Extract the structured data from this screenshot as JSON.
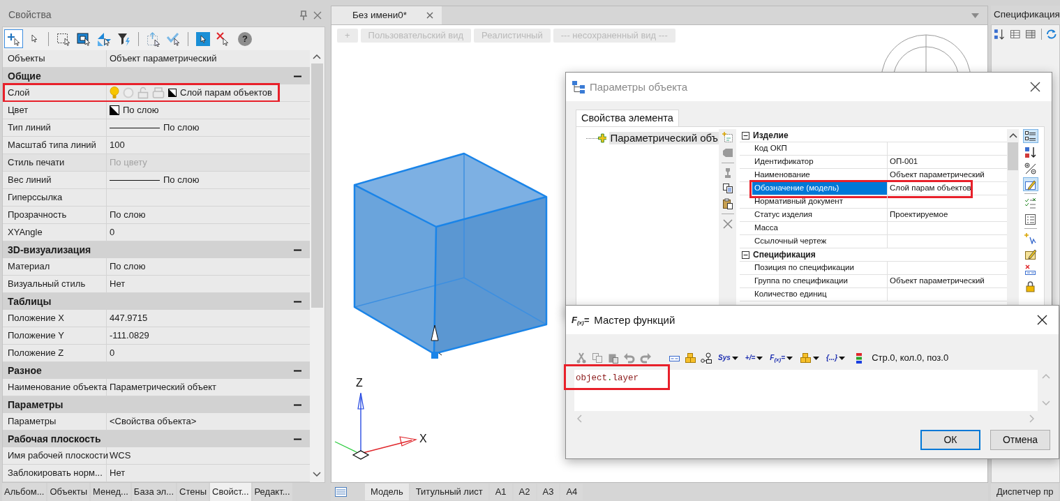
{
  "properties_panel": {
    "title": "Свойства",
    "toolbar": [
      {
        "kind": "tool",
        "selected": true
      },
      {
        "kind": "tool",
        "selected": false
      },
      {
        "kind": "separator"
      },
      {
        "kind": "tool",
        "selected": false
      },
      {
        "kind": "tool",
        "selected": false
      },
      {
        "kind": "tool",
        "selected": false
      },
      {
        "kind": "tool",
        "selected": false
      },
      {
        "kind": "separator"
      },
      {
        "kind": "tool",
        "selected": false
      },
      {
        "kind": "tool",
        "selected": false
      },
      {
        "kind": "separator"
      },
      {
        "kind": "tool",
        "selected": false
      },
      {
        "kind": "tool",
        "selected": false
      },
      {
        "kind": "help",
        "label": "?",
        "selected": false
      }
    ],
    "summary": {
      "name": "Объекты",
      "value": "Объект параметрический"
    },
    "sections": [
      {
        "title": "Общие",
        "expanded": true,
        "rows": [
          {
            "name": "Слой",
            "value": "Слой парам объектов",
            "kind": "layer",
            "disabled": false,
            "highlighted": true
          },
          {
            "name": "Цвет",
            "value": "По слою",
            "kind": "color",
            "disabled": false,
            "highlighted": false
          },
          {
            "name": "Тип линий",
            "value": "По слою",
            "kind": "linetype",
            "disabled": false,
            "highlighted": false
          },
          {
            "name": "Масштаб типа линий",
            "value": "100",
            "kind": "text",
            "disabled": false,
            "highlighted": false
          },
          {
            "name": "Стиль печати",
            "value": "По цвету",
            "kind": "text",
            "disabled": true,
            "highlighted": false
          },
          {
            "name": "Вес линий",
            "value": "По слою",
            "kind": "linetype",
            "disabled": false,
            "highlighted": false
          },
          {
            "name": "Гиперссылка",
            "kind": "text",
            "disabled": false,
            "highlighted": false
          },
          {
            "name": "Прозрачность",
            "value": "По слою",
            "kind": "text",
            "disabled": false,
            "highlighted": false
          },
          {
            "name": "XYAngle",
            "value": "0",
            "kind": "text",
            "disabled": false,
            "highlighted": false
          }
        ]
      },
      {
        "title": "3D-визуализация",
        "expanded": true,
        "rows": [
          {
            "name": "Материал",
            "value": "По слою",
            "kind": "text",
            "disabled": false,
            "highlighted": false
          },
          {
            "name": "Визуальный стиль",
            "value": "Нет",
            "kind": "text",
            "disabled": false,
            "highlighted": false
          }
        ]
      },
      {
        "title": "Таблицы",
        "expanded": true,
        "rows": [
          {
            "name": "Положение X",
            "value": "447.9715",
            "kind": "text",
            "disabled": false,
            "highlighted": false
          },
          {
            "name": "Положение Y",
            "value": "-111.0829",
            "kind": "text",
            "disabled": false,
            "highlighted": false
          },
          {
            "name": "Положение Z",
            "value": "0",
            "kind": "text",
            "disabled": false,
            "highlighted": false
          }
        ]
      },
      {
        "title": "Разное",
        "expanded": true,
        "rows": [
          {
            "name": "Наименование объекта",
            "value": "Параметрический объект",
            "kind": "text",
            "disabled": false,
            "highlighted": false
          }
        ]
      },
      {
        "title": "Параметры",
        "expanded": true,
        "rows": [
          {
            "name": "Параметры",
            "value": "<Свойства объекта>",
            "kind": "text",
            "disabled": false,
            "highlighted": false
          }
        ]
      },
      {
        "title": "Рабочая плоскость",
        "expanded": true,
        "rows": [
          {
            "name": "Имя рабочей плоскости",
            "value": "WCS",
            "kind": "text",
            "disabled": false,
            "highlighted": false
          },
          {
            "name": "Заблокировать норм...",
            "value": "Нет",
            "kind": "text",
            "disabled": false,
            "highlighted": false
          }
        ]
      }
    ],
    "tabs": [
      {
        "label": "Альбом...",
        "selected": false
      },
      {
        "label": "Объекты",
        "selected": false
      },
      {
        "label": "Менед...",
        "selected": false
      },
      {
        "label": "База эл...",
        "selected": false
      },
      {
        "label": "Стены",
        "selected": false
      },
      {
        "label": "Свойст...",
        "selected": true
      },
      {
        "label": "Редакт...",
        "selected": false
      }
    ]
  },
  "document": {
    "tabs": [
      {
        "label": "Без имени0*",
        "selected": true
      }
    ],
    "view_controls": [
      "+",
      "Пользовательский вид",
      "Реалистичный",
      "--- несохраненный вид ---"
    ],
    "axes": {
      "z_label": "Z",
      "x_label": "X"
    },
    "layout_tabs": [
      {
        "label": "Модель",
        "selected": true
      },
      {
        "label": "Титульный лист",
        "selected": false
      },
      {
        "label": "A1",
        "selected": false
      },
      {
        "label": "A2",
        "selected": false
      },
      {
        "label": "A3",
        "selected": false
      },
      {
        "label": "A4",
        "selected": false
      }
    ]
  },
  "specification_panel": {
    "title": "Спецификация",
    "tab": "Диспетчер пр"
  },
  "object_parameters_dialog": {
    "title": "Параметры объекта",
    "tabs": [
      {
        "label": "Свойства элемента",
        "selected": true
      }
    ],
    "tree": [
      {
        "label": "Параметрический объ",
        "selected": true
      }
    ],
    "sections": [
      {
        "title": "Изделие",
        "expanded": true,
        "rows": [
          {
            "name": "Код ОКП",
            "selected": false,
            "highlighted": false
          },
          {
            "name": "Идентификатор",
            "value": "ОП-001",
            "selected": false,
            "highlighted": false
          },
          {
            "name": "Наименование",
            "value": "Объект параметрический",
            "selected": false,
            "highlighted": false
          },
          {
            "name": "Обозначение (модель)",
            "value": "Слой парам объектов",
            "selected": true,
            "highlighted": true
          },
          {
            "name": "Нормативный документ",
            "selected": false,
            "highlighted": false
          },
          {
            "name": "Статус изделия",
            "value": "Проектируемое",
            "selected": false,
            "highlighted": false
          },
          {
            "name": "Масса",
            "selected": false,
            "highlighted": false
          },
          {
            "name": "Ссылочный чертеж",
            "selected": false,
            "highlighted": false
          }
        ]
      },
      {
        "title": "Спецификация",
        "expanded": true,
        "rows": [
          {
            "name": "Позиция по спецификации",
            "selected": false,
            "highlighted": false
          },
          {
            "name": "Группа по спецификации",
            "value": "Объект параметрический",
            "selected": false,
            "highlighted": false
          },
          {
            "name": "Количество единиц",
            "selected": false,
            "highlighted": false
          }
        ]
      }
    ],
    "tools": [
      {
        "kind": "tool",
        "selected": true
      },
      {
        "kind": "tool",
        "selected": false
      },
      {
        "kind": "tool",
        "selected": false
      },
      {
        "kind": "tool",
        "selected": true
      },
      {
        "kind": "separator"
      },
      {
        "kind": "tool",
        "selected": false
      },
      {
        "kind": "tool",
        "selected": false
      },
      {
        "kind": "separator"
      },
      {
        "kind": "tool",
        "selected": false
      },
      {
        "kind": "tool",
        "selected": false
      },
      {
        "kind": "tool",
        "selected": false
      },
      {
        "kind": "tool",
        "selected": false
      }
    ]
  },
  "function_wizard_dialog": {
    "title": "Мастер функций",
    "icon_label": "F$_{(x)}$=",
    "menus": [
      {
        "kind": "text",
        "label": "Sys"
      },
      {
        "kind": "text",
        "label": "+/="
      },
      {
        "kind": "text",
        "label": "F$_{(x)}$="
      },
      {
        "kind": "icon"
      },
      {
        "kind": "text",
        "label": "{...}"
      }
    ],
    "cursor_position": "Стр.0, кол.0, поз.0",
    "formula": {
      "tokens": [
        {
          "text": "object",
          "kind": "name"
        },
        {
          "text": ".",
          "kind": "operator"
        },
        {
          "text": "layer",
          "kind": "name"
        }
      ],
      "highlighted": true
    },
    "buttons": [
      {
        "label": "ОК",
        "default": true
      },
      {
        "label": "Отмена",
        "default": false
      }
    ]
  }
}
